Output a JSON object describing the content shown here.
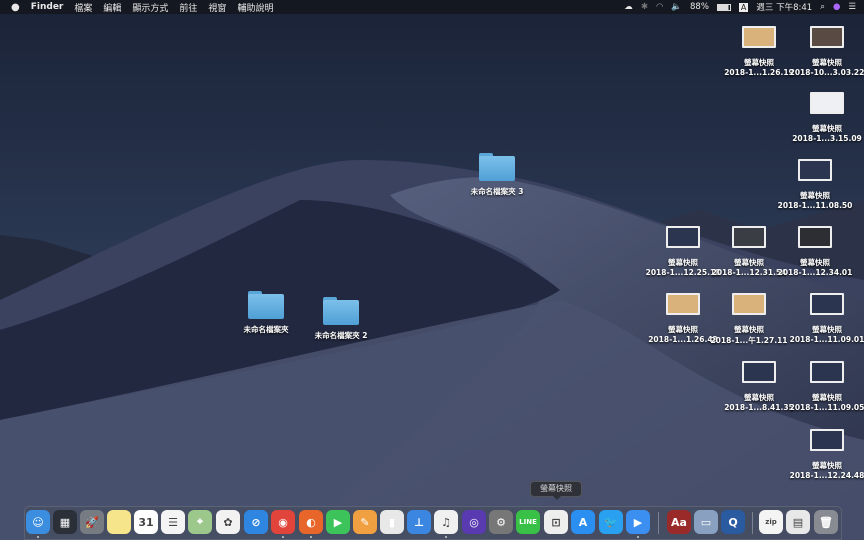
{
  "menubar": {
    "apple": "",
    "app": "Finder",
    "items": [
      "檔案",
      "編輯",
      "顯示方式",
      "前往",
      "視窗",
      "輔助說明"
    ],
    "status": {
      "battery": "88%",
      "input": "A",
      "clock": "週三 下午8:41"
    }
  },
  "desktop": {
    "folders": [
      {
        "label": "未命名檔案夾 3"
      },
      {
        "label": "未命名檔案夾"
      },
      {
        "label": "未命名檔案夾 2"
      }
    ],
    "screenshots": [
      {
        "label": "螢幕快照",
        "sub": "2018-1...1.26.19",
        "thumb": "#d8b27a"
      },
      {
        "label": "螢幕快照",
        "sub": "2018-10...3.03.22",
        "thumb": "#5a4a44"
      },
      {
        "label": "螢幕快照",
        "sub": "2018-1...3.15.09",
        "thumb": "#eef0f4"
      },
      {
        "label": "螢幕快照",
        "sub": "2018-1...11.08.50",
        "thumb": "#2b3550"
      },
      {
        "label": "螢幕快照",
        "sub": "2018-1...12.25.18",
        "thumb": "#2b3550"
      },
      {
        "label": "螢幕快照",
        "sub": "2018-1...12.31.54",
        "thumb": "#3a3d44"
      },
      {
        "label": "螢幕快照",
        "sub": "2018-1...12.34.01",
        "thumb": "#2c2e34"
      },
      {
        "label": "螢幕快照",
        "sub": "2018-1...1.26.42",
        "thumb": "#d8b27a"
      },
      {
        "label": "螢幕快照",
        "sub": "2018-1...午1.27.11",
        "thumb": "#d8b27a"
      },
      {
        "label": "螢幕快照",
        "sub": "2018-1...11.09.01",
        "thumb": "#2b3550"
      },
      {
        "label": "螢幕快照",
        "sub": "2018-1...8.41.35",
        "thumb": "#2b3550"
      },
      {
        "label": "螢幕快照",
        "sub": "2018-1...11.09.05",
        "thumb": "#2b3550"
      },
      {
        "label": "螢幕快照",
        "sub": "2018-1...12.24.48",
        "thumb": "#2b3550"
      }
    ]
  },
  "dock": {
    "tooltip": "螢幕快照",
    "items": [
      {
        "name": "finder",
        "color": "#3b8de0",
        "glyph": "☺",
        "running": true
      },
      {
        "name": "mission-control",
        "color": "#2a2f38",
        "glyph": "▦"
      },
      {
        "name": "launchpad",
        "color": "#777b82",
        "glyph": "🚀"
      },
      {
        "name": "notes",
        "color": "#f6e58a",
        "glyph": ""
      },
      {
        "name": "calendar",
        "color": "#ffffff",
        "glyph": "31"
      },
      {
        "name": "reminders",
        "color": "#f4f4f4",
        "glyph": "☰"
      },
      {
        "name": "maps",
        "color": "#9cc88c",
        "glyph": "⌖"
      },
      {
        "name": "photos",
        "color": "#f2f2f2",
        "glyph": "✿"
      },
      {
        "name": "safari",
        "color": "#2f86e0",
        "glyph": "⊘"
      },
      {
        "name": "chrome",
        "color": "#e0443a",
        "glyph": "◉",
        "running": true
      },
      {
        "name": "firefox",
        "color": "#e8662a",
        "glyph": "◐",
        "running": true
      },
      {
        "name": "facetime",
        "color": "#3cc45a",
        "glyph": "▶"
      },
      {
        "name": "pages",
        "color": "#f0a040",
        "glyph": "✎"
      },
      {
        "name": "numbers",
        "color": "#e8e8e8",
        "glyph": "▮"
      },
      {
        "name": "keynote",
        "color": "#3a86e0",
        "glyph": "⊥"
      },
      {
        "name": "itunes",
        "color": "#f0f0f0",
        "glyph": "♫",
        "running": true
      },
      {
        "name": "siri",
        "color": "#5a3ab0",
        "glyph": "◎"
      },
      {
        "name": "system-preferences",
        "color": "#777",
        "glyph": "⚙"
      },
      {
        "name": "line",
        "color": "#39c046",
        "glyph": "LINE"
      },
      {
        "name": "screenshot",
        "color": "#eeeeee",
        "glyph": "⊡"
      },
      {
        "name": "app-store",
        "color": "#2a8ff0",
        "glyph": "A"
      },
      {
        "name": "twitter",
        "color": "#2aa0f0",
        "glyph": "🐦"
      },
      {
        "name": "quicktime-player",
        "color": "#3a8ff0",
        "glyph": "▶",
        "running": true
      },
      {
        "name": "dictionary",
        "color": "#9a2a2a",
        "glyph": "Aa"
      },
      {
        "name": "preview",
        "color": "#8aa0c0",
        "glyph": "▭"
      },
      {
        "name": "quicktime",
        "color": "#2a5aa0",
        "glyph": "Q"
      },
      {
        "name": "archive",
        "color": "#f4f4f4",
        "glyph": "zip"
      },
      {
        "name": "document",
        "color": "#e8e8e8",
        "glyph": "▤"
      },
      {
        "name": "trash",
        "color": "#888c92",
        "glyph": "🗑"
      }
    ]
  }
}
